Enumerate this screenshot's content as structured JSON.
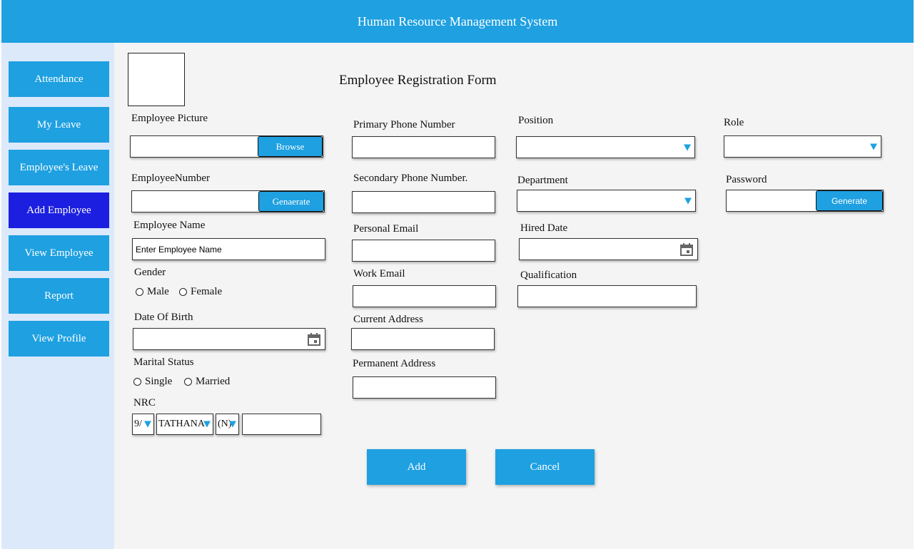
{
  "app": {
    "title": "Human Resource Management System"
  },
  "sidebar": {
    "items": [
      {
        "label": "Attendance"
      },
      {
        "label": "My Leave"
      },
      {
        "label": "Employee's Leave"
      },
      {
        "label": "Add Employee"
      },
      {
        "label": "View Employee"
      },
      {
        "label": "Report"
      },
      {
        "label": "View Profile"
      }
    ],
    "active_index": 3
  },
  "form": {
    "title": "Employee Registration Form",
    "employee_picture": {
      "label": "Employee Picture",
      "button": "Browse"
    },
    "employee_number": {
      "label": "EmployeeNumber",
      "button": "Genaerate"
    },
    "employee_name": {
      "label": "Employee Name",
      "placeholder": "Enter Employee Name"
    },
    "gender": {
      "label": "Gender",
      "options": [
        "Male",
        "Female"
      ]
    },
    "dob": {
      "label": "Date Of Birth"
    },
    "marital_status": {
      "label": "Marital Status",
      "options": [
        "Single",
        "Married"
      ]
    },
    "nrc": {
      "label": "NRC",
      "state": "9/",
      "township": "TATHANA",
      "type": "(N)"
    },
    "primary_phone": {
      "label": "Primary Phone Number"
    },
    "secondary_phone": {
      "label": "Secondary Phone Number."
    },
    "personal_email": {
      "label": "Personal Email"
    },
    "work_email": {
      "label": "Work Email"
    },
    "current_address": {
      "label": "Current Address"
    },
    "permanent_address": {
      "label": "Permanent Address"
    },
    "position": {
      "label": "Position"
    },
    "department": {
      "label": "Department"
    },
    "hired_date": {
      "label": "Hired Date"
    },
    "qualification": {
      "label": "Qualification"
    },
    "role": {
      "label": "Role"
    },
    "password": {
      "label": "Password",
      "button": "Generate"
    },
    "actions": {
      "add": "Add",
      "cancel": "Cancel"
    }
  },
  "colors": {
    "accent": "#1ea0e1",
    "active_nav": "#1c1fe0",
    "sidebar_bg": "#dce9fa",
    "main_bg": "#f4f4f4"
  }
}
